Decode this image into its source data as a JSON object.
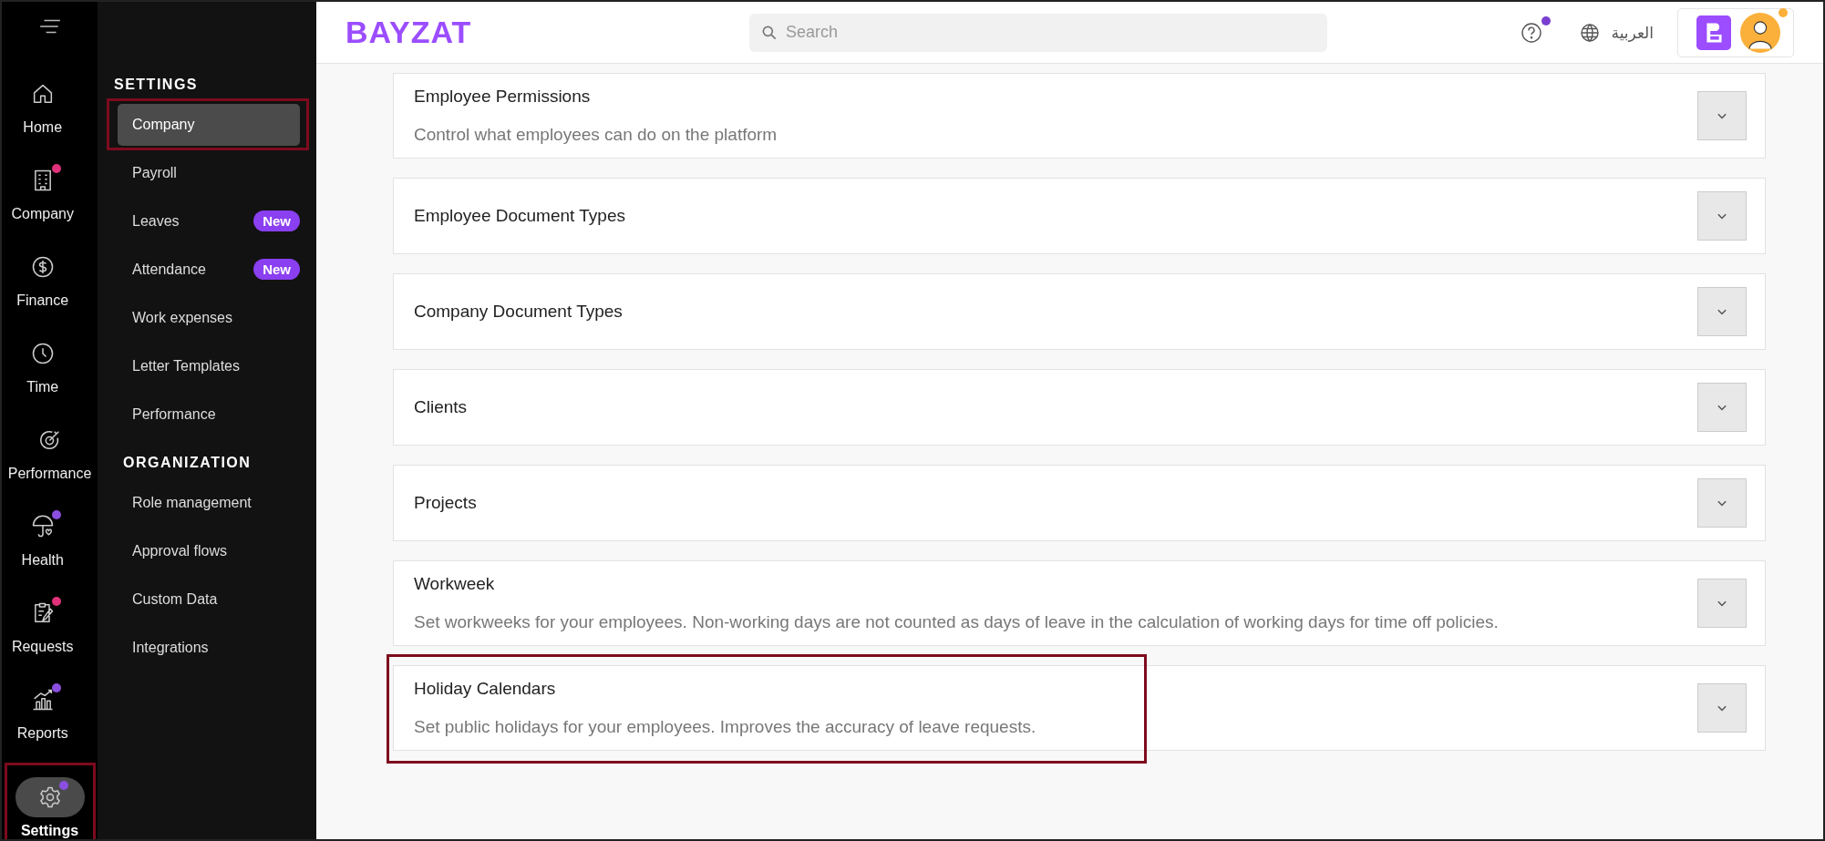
{
  "rail": {
    "items": [
      {
        "label": "Home",
        "selected": false,
        "annotated": false
      },
      {
        "label": "Company",
        "selected": false,
        "annotated": false,
        "color": "#e0317a"
      },
      {
        "label": "Finance",
        "selected": false,
        "annotated": false
      },
      {
        "label": "Time",
        "selected": false,
        "annotated": false
      },
      {
        "label": "Performance",
        "selected": false,
        "annotated": false
      },
      {
        "label": "Health",
        "selected": false,
        "annotated": false,
        "color": "#8a4fe0"
      },
      {
        "label": "Requests",
        "selected": false,
        "annotated": false,
        "color": "#e0317a"
      },
      {
        "label": "Reports",
        "selected": false,
        "annotated": false,
        "color": "#8a4fe0"
      }
    ],
    "bottom": {
      "label": "Settings",
      "selected": true,
      "annotated": true,
      "color": "#8a4fe0"
    }
  },
  "submenu": {
    "sections": [
      {
        "heading": "SETTINGS",
        "items": [
          {
            "label": "Company",
            "selected": true,
            "annotated": true
          },
          {
            "label": "Payroll",
            "selected": false,
            "annotated": false
          },
          {
            "label": "Leaves",
            "selected": false,
            "annotated": false,
            "badge": "New"
          },
          {
            "label": "Attendance",
            "selected": false,
            "annotated": false,
            "badge": "New"
          },
          {
            "label": "Work expenses",
            "selected": false,
            "annotated": false
          },
          {
            "label": "Letter Templates",
            "selected": false,
            "annotated": false
          },
          {
            "label": "Performance",
            "selected": false,
            "annotated": false
          }
        ]
      },
      {
        "heading": "ORGANIZATION",
        "items": [
          {
            "label": "Role management",
            "selected": false,
            "annotated": false
          },
          {
            "label": "Approval flows",
            "selected": false,
            "annotated": false
          },
          {
            "label": "Custom Data",
            "selected": false,
            "annotated": false
          },
          {
            "label": "Integrations",
            "selected": false,
            "annotated": false
          }
        ]
      }
    ]
  },
  "topbar": {
    "logo": "BAYZAT",
    "search": {
      "placeholder": "Search"
    },
    "help_notification": true,
    "language": "العربية",
    "account_notification": true
  },
  "cards": [
    {
      "title": "Employee Permissions",
      "description": "Control what employees can do on the platform",
      "expanded": false,
      "annotated": false
    },
    {
      "title": "Employee Document Types",
      "expanded": false,
      "annotated": false
    },
    {
      "title": "Company Document Types",
      "expanded": false,
      "annotated": false
    },
    {
      "title": "Clients",
      "expanded": false,
      "annotated": false
    },
    {
      "title": "Projects",
      "expanded": false,
      "annotated": false
    },
    {
      "title": "Workweek",
      "description": "Set workweeks for your employees. Non-working days are not counted as days of leave in the calculation of working days for time off policies.",
      "expanded": false,
      "annotated": false
    },
    {
      "title": "Holiday Calendars",
      "description": "Set public holidays for your employees. Improves the accuracy of leave requests.",
      "expanded": false,
      "annotated": true
    }
  ]
}
